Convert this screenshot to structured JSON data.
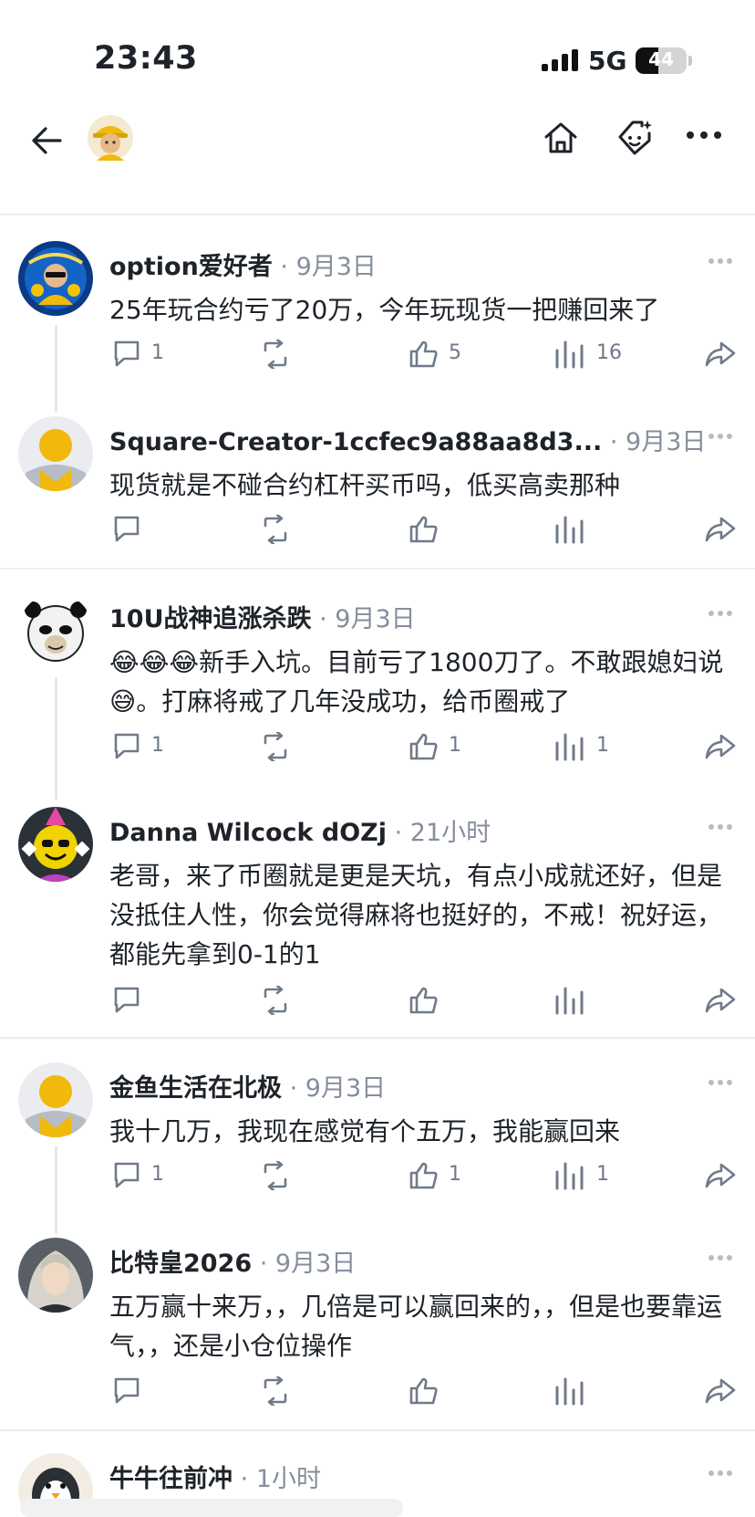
{
  "status": {
    "time": "23:43",
    "network": "5G",
    "battery": "44",
    "battery_level": 0.44
  },
  "nav": {
    "back_icon": "arrow-left-icon",
    "home_icon": "home-icon",
    "tag_icon": "tag-icon",
    "more_icon": "more-icon"
  },
  "comments": [
    {
      "author": "option爱好者",
      "date": "9月3日",
      "text": "25年玩合约亏了20万，今年玩现货一把赚回来了",
      "replies": "1",
      "likes": "5",
      "views": "16",
      "avatar": "btc-leaps-avatar"
    },
    {
      "author": "Square-Creator-1ccfec9a88aa8d3...",
      "date": "9月3日",
      "text": "现货就是不碰合约杠杆买币吗，低买高卖那种",
      "replies": "",
      "likes": "",
      "views": "",
      "avatar": "default-avatar"
    },
    {
      "author": "10U战神追涨杀跌",
      "date": "9月3日",
      "text": "😂😂😂新手入坑。目前亏了1800刀了。不敢跟媳妇说😅。打麻将戒了几年没成功，给币圈戒了",
      "replies": "1",
      "likes": "1",
      "views": "1",
      "avatar": "panda-avatar"
    },
    {
      "author": "Danna Wilcock dOZj",
      "date": "21小时",
      "text": "老哥，来了币圈就是更是天坑，有点小成就还好，但是没抵住人性，你会觉得麻将也挺好的，不戒！祝好运，都能先拿到0-1的1",
      "replies": "",
      "likes": "",
      "views": "",
      "avatar": "party-smiley-avatar"
    },
    {
      "author": "金鱼生活在北极",
      "date": "9月3日",
      "text": "我十几万，我现在感觉有个五万，我能赢回来",
      "replies": "1",
      "likes": "1",
      "views": "1",
      "avatar": "default-avatar"
    },
    {
      "author": "比特皇2026",
      "date": "9月3日",
      "text": "五万赢十来万，，几倍是可以赢回来的，，但是也要靠运气，，还是小仓位操作",
      "replies": "",
      "likes": "",
      "views": "",
      "avatar": "anime-avatar"
    },
    {
      "author": "牛牛往前冲",
      "date": "1小时",
      "text": "",
      "replies": "",
      "likes": "",
      "views": "",
      "avatar": "penguin-avatar"
    }
  ],
  "icons": {
    "reply": "comment-icon",
    "repost": "repost-icon",
    "like": "thumbs-up-icon",
    "views": "views-icon",
    "share": "share-icon",
    "more": "more-horizontal-icon"
  },
  "colors": {
    "text": "#1e2329",
    "muted": "#848e9c",
    "icon": "#707a8a",
    "brand": "#f0b90b"
  }
}
